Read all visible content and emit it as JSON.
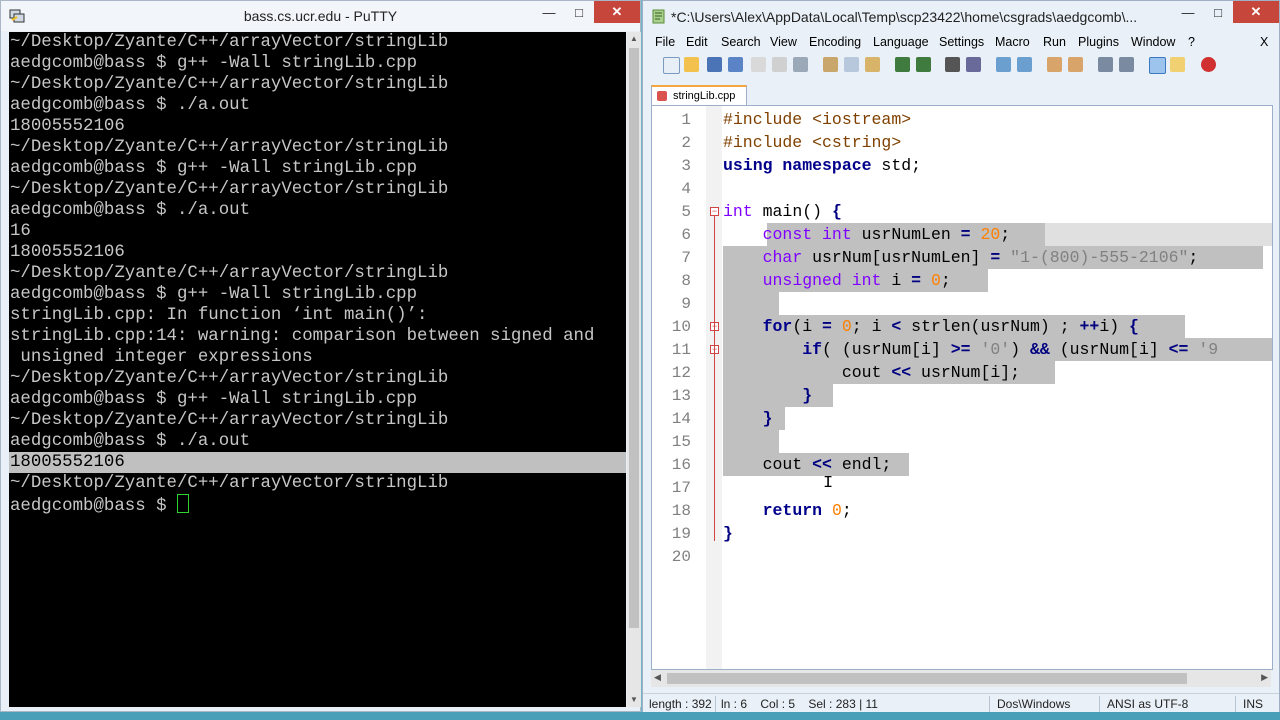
{
  "putty": {
    "title": "bass.cs.ucr.edu - PuTTY",
    "terminal_lines": [
      "~/Desktop/Zyante/C++/arrayVector/stringLib",
      "aedgcomb@bass $ g++ -Wall stringLib.cpp",
      "~/Desktop/Zyante/C++/arrayVector/stringLib",
      "aedgcomb@bass $ ./a.out",
      "18005552106",
      "~/Desktop/Zyante/C++/arrayVector/stringLib",
      "aedgcomb@bass $ g++ -Wall stringLib.cpp",
      "~/Desktop/Zyante/C++/arrayVector/stringLib",
      "aedgcomb@bass $ ./a.out",
      "16",
      "18005552106",
      "~/Desktop/Zyante/C++/arrayVector/stringLib",
      "aedgcomb@bass $ g++ -Wall stringLib.cpp",
      "stringLib.cpp: In function ‘int main()’:",
      "stringLib.cpp:14: warning: comparison between signed and",
      " unsigned integer expressions",
      "~/Desktop/Zyante/C++/arrayVector/stringLib",
      "aedgcomb@bass $ g++ -Wall stringLib.cpp",
      "~/Desktop/Zyante/C++/arrayVector/stringLib",
      "aedgcomb@bass $ ./a.out",
      "18005552106",
      "~/Desktop/Zyante/C++/arrayVector/stringLib"
    ],
    "prompt": "aedgcomb@bass $ ",
    "selected_line_index": 20
  },
  "npp": {
    "title": "*C:\\Users\\Alex\\AppData\\Local\\Temp\\scp23422\\home\\csgrads\\aedgcomb\\...",
    "menu": [
      "File",
      "Edit",
      "Search",
      "View",
      "Encoding",
      "Language",
      "Settings",
      "Macro",
      "Run",
      "Plugins",
      "Window",
      "?"
    ],
    "close_doc": "X",
    "tab_label": "stringLib.cpp",
    "line_numbers": [
      "1",
      "2",
      "3",
      "4",
      "5",
      "6",
      "7",
      "8",
      "9",
      "10",
      "11",
      "12",
      "13",
      "14",
      "15",
      "16",
      "17",
      "18",
      "19",
      "20"
    ],
    "status": {
      "length": "length : 392",
      "position": "ln : 6    Col : 5    Sel : 283 | 11",
      "eol": "Dos\\Windows",
      "encoding": "ANSI as UTF-8",
      "mode": "INS"
    }
  }
}
